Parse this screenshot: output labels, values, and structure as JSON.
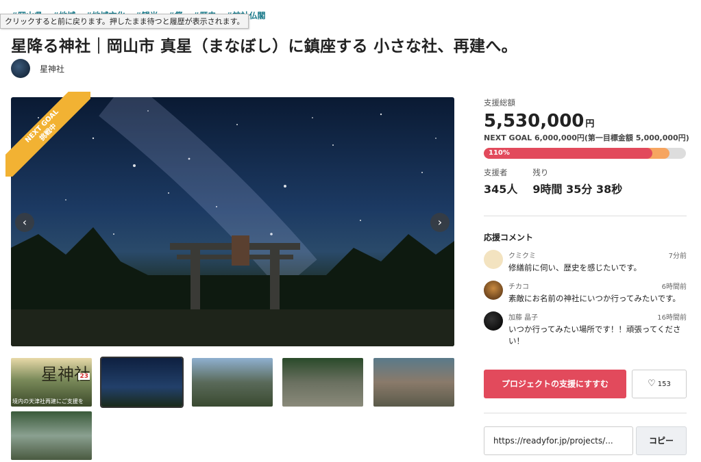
{
  "tags": [
    "#岡山県",
    "#地域",
    "#地域文化",
    "#観光",
    "#祭",
    "#歴史",
    "#神社仏閣"
  ],
  "tooltip": "クリックすると前に戻ります。押したまま待つと履歴が表示されます。",
  "title": "星降る神社｜岡山市 真星（まなぼし）に鎮座する 小さな社、再建へ。",
  "owner": {
    "name": "星神社"
  },
  "hero": {
    "ribbon_line1": "NEXT GOAL",
    "ribbon_line2": "挑戦中",
    "prev_icon": "‹",
    "next_icon": "›"
  },
  "thumbnails": {
    "thumb1_title": "星神社",
    "thumb1_badge": "23",
    "thumb1_caption": "境内の天津社再建にご支援を"
  },
  "stats": {
    "total_label": "支援総額",
    "total_amount": "5,530,000",
    "currency": "円",
    "next_goal": "NEXT GOAL 6,000,000円(第一目標金額 5,000,000円)",
    "progress_text": "110%",
    "progress_percent": 110,
    "supporters_label": "支援者",
    "supporters_value": "345人",
    "remaining_label": "残り",
    "remaining_value": "9時間 35分 38秒"
  },
  "colors": {
    "accent": "#e24a5c",
    "ribbon": "#f2b233",
    "progress_next": "#f6a560",
    "tag": "#1a7a8a"
  },
  "comments": {
    "title": "応援コメント",
    "items": [
      {
        "name": "クミクミ",
        "time": "7分前",
        "text": "修繕前に伺い、歴史を感じたいです。"
      },
      {
        "name": "チカコ",
        "time": "6時間前",
        "text": "素敵にお名前の神社にいつか行ってみたいです。"
      },
      {
        "name": "加藤 晶子",
        "time": "16時間前",
        "text": "いつか行ってみたい場所です！！頑張ってください！"
      }
    ]
  },
  "actions": {
    "support_label": "プロジェクトの支援にすすむ",
    "like_icon": "♡",
    "like_count": "153",
    "url": "https://readyfor.jp/projects/...",
    "copy_label": "コピー"
  }
}
